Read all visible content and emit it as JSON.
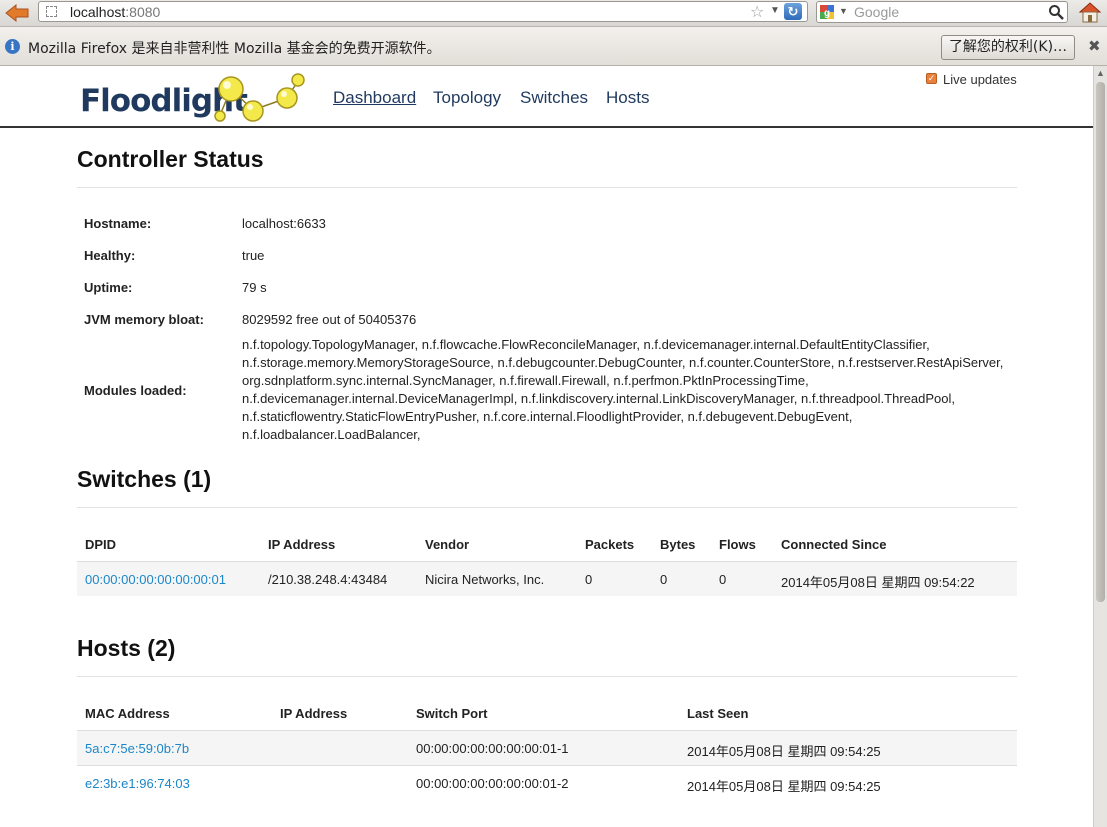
{
  "browser": {
    "url_host": "localhost",
    "url_port": ":8080",
    "search_placeholder": "Google",
    "infobar_text": "Mozilla Firefox 是来自非营利性 Mozilla 基金会的免费开源软件。",
    "infobar_button": "了解您的权利(K)…"
  },
  "nav": {
    "brand": "Floodlight",
    "items": [
      "Dashboard",
      "Topology",
      "Switches",
      "Hosts"
    ],
    "live_updates": "Live updates"
  },
  "status": {
    "title": "Controller Status",
    "hostname_label": "Hostname:",
    "hostname": "localhost:6633",
    "healthy_label": "Healthy:",
    "healthy": "true",
    "uptime_label": "Uptime:",
    "uptime": "79 s",
    "jvm_label": "JVM memory bloat:",
    "jvm": "8029592 free out of 50405376",
    "modules_label": "Modules loaded:",
    "modules_lines": [
      "n.f.topology.TopologyManager, n.f.flowcache.FlowReconcileManager, n.f.devicemanager.internal.DefaultEntityClassifier,",
      "n.f.storage.memory.MemoryStorageSource, n.f.debugcounter.DebugCounter, n.f.counter.CounterStore, n.f.restserver.RestApiServer,",
      "org.sdnplatform.sync.internal.SyncManager, n.f.firewall.Firewall, n.f.perfmon.PktInProcessingTime,",
      "n.f.devicemanager.internal.DeviceManagerImpl, n.f.linkdiscovery.internal.LinkDiscoveryManager, n.f.threadpool.ThreadPool,",
      "n.f.staticflowentry.StaticFlowEntryPusher, n.f.core.internal.FloodlightProvider, n.f.debugevent.DebugEvent,",
      "n.f.loadbalancer.LoadBalancer,"
    ]
  },
  "switches": {
    "title": "Switches (1)",
    "headers": [
      "DPID",
      "IP Address",
      "Vendor",
      "Packets",
      "Bytes",
      "Flows",
      "Connected Since"
    ],
    "rows": [
      [
        "00:00:00:00:00:00:00:01",
        "/210.38.248.4:43484",
        "Nicira Networks, Inc.",
        "0",
        "0",
        "0",
        "2014年05月08日 星期四 09:54:22"
      ]
    ]
  },
  "hosts": {
    "title": "Hosts (2)",
    "headers": [
      "MAC Address",
      "IP Address",
      "Switch Port",
      "Last Seen"
    ],
    "rows": [
      [
        "5a:c7:5e:59:0b:7b",
        "",
        "00:00:00:00:00:00:00:01-1",
        "2014年05月08日 星期四 09:54:25"
      ],
      [
        "e2:3b:e1:96:74:03",
        "",
        "00:00:00:00:00:00:00:01-2",
        "2014年05月08日 星期四 09:54:25"
      ]
    ]
  },
  "colors": {
    "link": "#1b87c9",
    "brand": "#1f3a5e",
    "logo_ball": "#f3e94a"
  }
}
